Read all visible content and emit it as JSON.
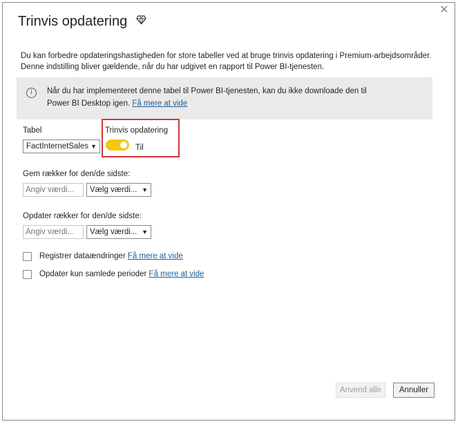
{
  "dialog": {
    "title": "Trinvis opdatering",
    "close_glyph": "✕",
    "premium_icon": "diamond-icon",
    "description_line1": "Du kan forbedre opdateringshastigheden for store tabeller ved at bruge trinvis opdatering i Premium-arbejdsområder.",
    "description_line2": "Denne indstilling bliver gældende, når du har udgivet en rapport til Power BI-tjenesten."
  },
  "info": {
    "icon": "info-icon",
    "line1": "Når du har implementeret denne tabel til Power BI-tjenesten, kan du ikke downloade den til",
    "line2_prefix": "Power BI Desktop igen.",
    "link": "Få mere at vide"
  },
  "table": {
    "label": "Tabel",
    "selected": "FactInternetSales"
  },
  "incremental": {
    "label": "Trinvis opdatering",
    "toggle_state": "Til",
    "toggle_on": true
  },
  "store_rows": {
    "label": "Gem rækker for den/de sidste:",
    "value_placeholder": "Angiv værdi...",
    "unit_selected": "Vælg værdi..."
  },
  "refresh_rows": {
    "label": "Opdater rækker for den/de sidste:",
    "value_placeholder": "Angiv værdi...",
    "unit_selected": "Vælg værdi..."
  },
  "options": {
    "detect_changes": {
      "label": "Registrer dataændringer",
      "link": "Få mere at vide",
      "checked": false
    },
    "complete_periods": {
      "label": "Opdater kun samlede perioder",
      "link": "Få mere at vide",
      "checked": false
    }
  },
  "buttons": {
    "apply_all": "Anvend alle",
    "cancel": "Annuller"
  },
  "colors": {
    "toggle_on": "#f2c811",
    "highlight_border": "#d13438",
    "link": "#1a5e9b",
    "info_bg": "#eaeaea"
  }
}
